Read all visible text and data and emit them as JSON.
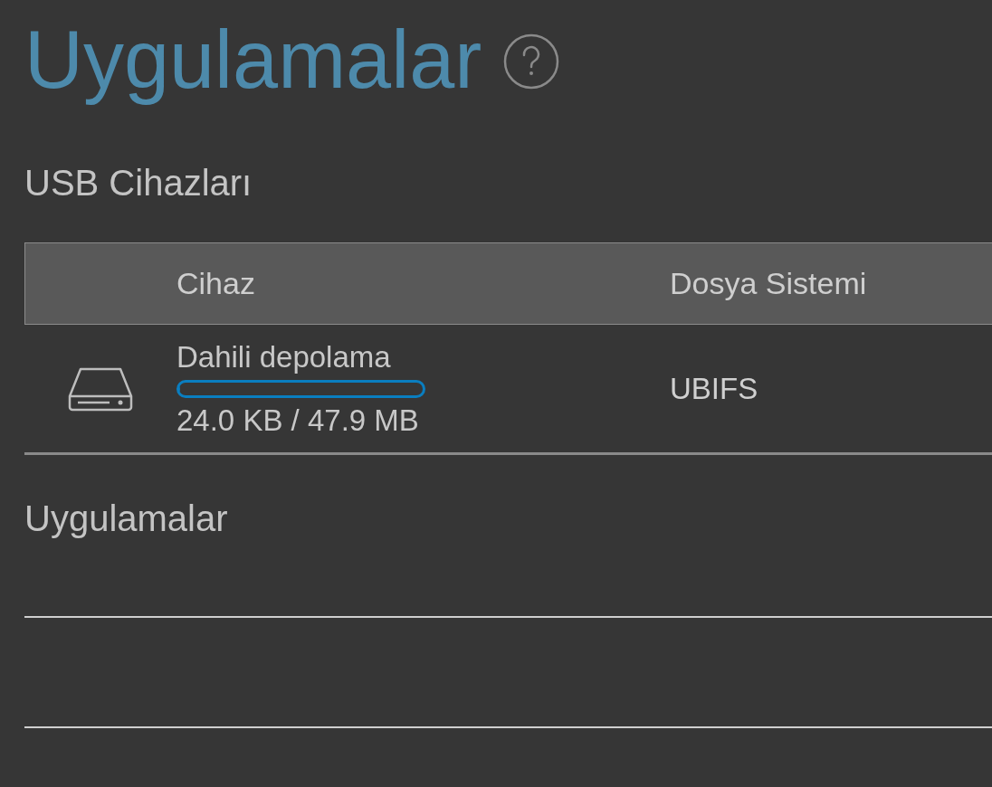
{
  "title": "Uygulamalar",
  "usb_section": {
    "heading": "USB Cihazları",
    "columns": [
      "Cihaz",
      "Dosya Sistemi"
    ],
    "rows": [
      {
        "name": "Dahili depolama",
        "level": 0.0005,
        "usage": "24.0 KB / 47.9 MB",
        "file_system": "UBIFS"
      }
    ]
  },
  "apps_section": {
    "heading": "Uygulamalar"
  }
}
